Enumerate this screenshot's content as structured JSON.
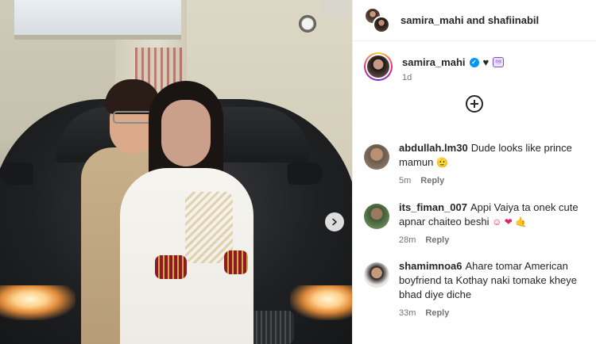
{
  "header": {
    "names": "samira_mahi and shafiinabil"
  },
  "caption": {
    "username": "samira_mahi",
    "verified_mark": "✓",
    "text_heart": "♥",
    "text_box": "♾",
    "time": "1d"
  },
  "add_icon": "plus-circle-icon",
  "comments": [
    {
      "username": "abdullah.lm30",
      "text": "Dude looks like prince mamun",
      "trailing": "🫡",
      "time": "5m",
      "reply": "Reply"
    },
    {
      "username": "its_fiman_007",
      "text": "Appi Vaiya ta onek cute apnar chaiteo beshi",
      "trailing": "☺ ❤ 🤙",
      "time": "28m",
      "reply": "Reply"
    },
    {
      "username": "shamimnoa6",
      "text": "Ahare tomar American boyfriend ta Kothay naki tomake kheye bhad diye diche",
      "time": "33m",
      "reply": "Reply"
    }
  ],
  "colors": {
    "verified": "#0095f6",
    "meta_text": "#737373",
    "primary_text": "#262626"
  }
}
